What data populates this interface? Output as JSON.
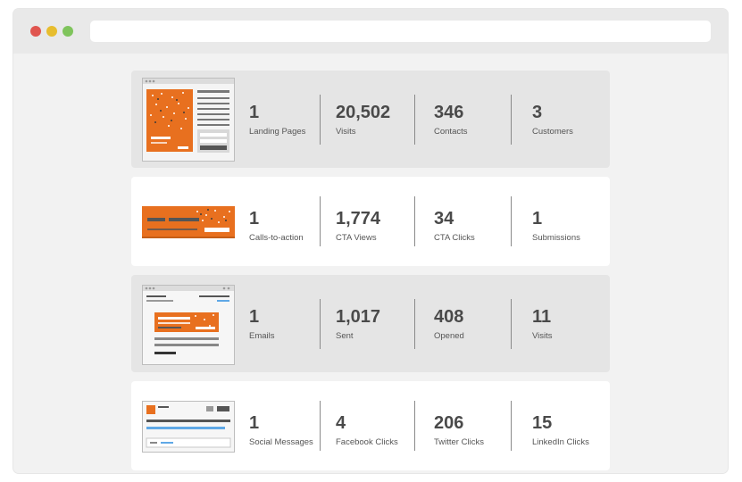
{
  "browser": {
    "controls": [
      "close",
      "minimize",
      "maximize"
    ],
    "address": ""
  },
  "colors": {
    "accent": "#e8701f",
    "link_blue": "#5fa8e6",
    "card_grey": "#e5e5e5",
    "text": "#4a4a4a"
  },
  "rows": [
    {
      "thumbnail": "landing-page-icon",
      "stats": [
        {
          "value": "1",
          "label": "Landing Pages"
        },
        {
          "value": "20,502",
          "label": "Visits"
        },
        {
          "value": "346",
          "label": "Contacts"
        },
        {
          "value": "3",
          "label": "Customers"
        }
      ]
    },
    {
      "thumbnail": "call-to-action-icon",
      "stats": [
        {
          "value": "1",
          "label": "Calls-to-action"
        },
        {
          "value": "1,774",
          "label": "CTA Views"
        },
        {
          "value": "34",
          "label": "CTA Clicks"
        },
        {
          "value": "1",
          "label": "Submissions"
        }
      ]
    },
    {
      "thumbnail": "email-icon",
      "stats": [
        {
          "value": "1",
          "label": "Emails"
        },
        {
          "value": "1,017",
          "label": "Sent"
        },
        {
          "value": "408",
          "label": "Opened"
        },
        {
          "value": "11",
          "label": "Visits"
        }
      ]
    },
    {
      "thumbnail": "social-message-icon",
      "stats": [
        {
          "value": "1",
          "label": "Social Messages"
        },
        {
          "value": "4",
          "label": "Facebook Clicks"
        },
        {
          "value": "206",
          "label": "Twitter Clicks"
        },
        {
          "value": "15",
          "label": "LinkedIn Clicks"
        }
      ]
    }
  ]
}
